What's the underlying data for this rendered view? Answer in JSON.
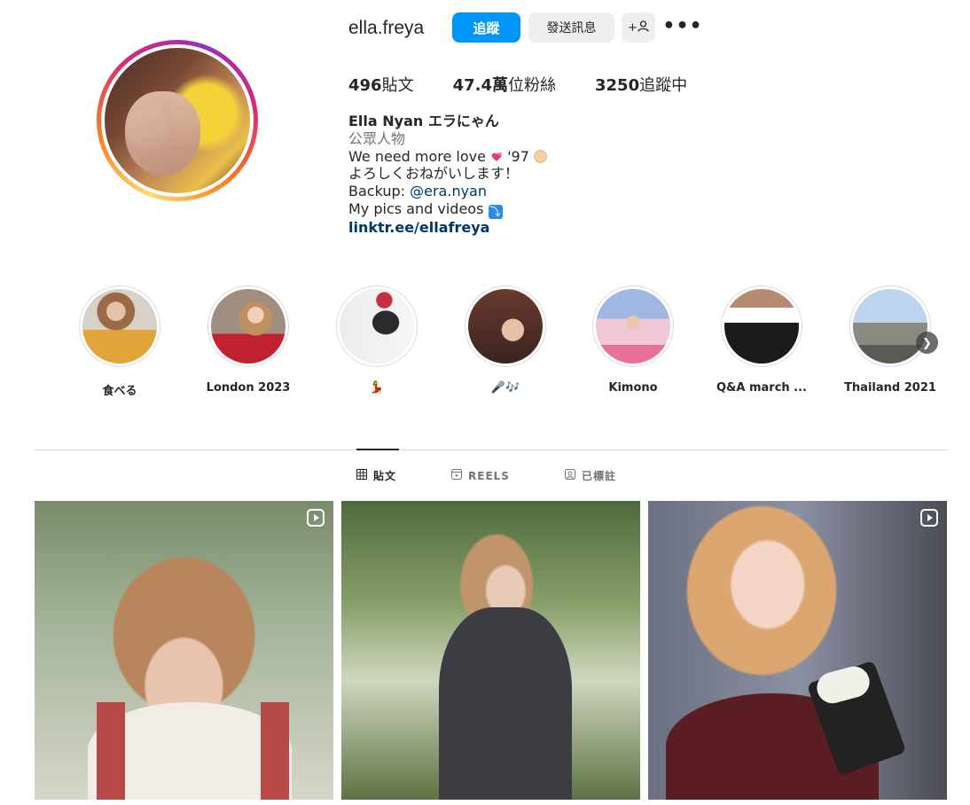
{
  "profile": {
    "username": "ella.freya",
    "follow_label": "追蹤",
    "message_label": "發送訊息",
    "add_user_label": "+웃",
    "more_label": "•••",
    "stats": {
      "posts_value": "496",
      "posts_label": "貼文",
      "followers_value": "47.4萬",
      "followers_label": "位粉絲",
      "following_value": "3250",
      "following_label": "追蹤中"
    },
    "bio": {
      "name": "Ella Nyan エラにゃん",
      "category": "公眾人物",
      "line1": "We need more love",
      "line1_tail": "'97",
      "line2": "よろしくおねがいします！",
      "line3_prefix": "Backup: ",
      "mention": "@era.nyan",
      "line4": "My pics and videos",
      "link": "linktr.ee/ellafreya"
    }
  },
  "highlights": [
    {
      "label": "食べる",
      "icon": "food-highlight"
    },
    {
      "label": "London 2023",
      "icon": "selfie-highlight"
    },
    {
      "label": "💃",
      "icon": "dance-highlight"
    },
    {
      "label": "🎤🎶",
      "icon": "music-highlight"
    },
    {
      "label": "Kimono",
      "icon": "kimono-highlight"
    },
    {
      "label": "Q&A march ...",
      "icon": "qa-highlight"
    },
    {
      "label": "Thailand 2021",
      "icon": "travel-highlight"
    }
  ],
  "tabs": [
    {
      "label": "貼文",
      "icon": "grid-icon",
      "active": true
    },
    {
      "label": "REELS",
      "icon": "reels-icon",
      "active": false
    },
    {
      "label": "已標註",
      "icon": "tagged-icon",
      "active": false
    }
  ],
  "colors": {
    "accent": "#0095f6",
    "text": "#262626",
    "muted": "#737373",
    "link": "#00376b"
  }
}
